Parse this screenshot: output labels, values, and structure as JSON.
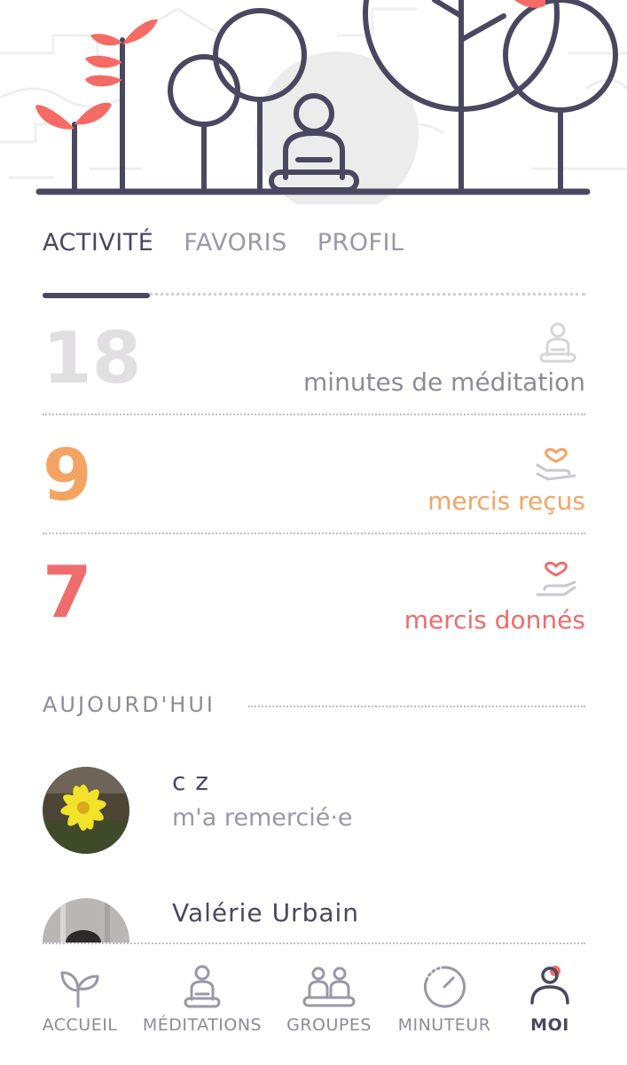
{
  "tabs": [
    {
      "label": "ACTIVITÉ",
      "active": true
    },
    {
      "label": "FAVORIS",
      "active": false
    },
    {
      "label": "PROFIL",
      "active": false
    }
  ],
  "stats": [
    {
      "value": "18",
      "label": "minutes de méditation",
      "color": "#e1dfe2",
      "label_color": "#8d8b98",
      "icon": "meditation-icon"
    },
    {
      "value": "9",
      "label": "mercis reçus",
      "color": "#f4a462",
      "label_color": "#f4a462",
      "icon": "heart-hand-received-icon"
    },
    {
      "value": "7",
      "label": "mercis donnés",
      "color": "#ef6c6c",
      "label_color": "#ef6c6c",
      "icon": "heart-hand-given-icon"
    }
  ],
  "section": {
    "title": "AUJOURD'HUI"
  },
  "activities": [
    {
      "name": "c z",
      "action": "m'a remercié·e",
      "avatar": "flower-avatar"
    },
    {
      "name": "Valérie  Urbain",
      "action": "",
      "avatar": "person-avatar"
    }
  ],
  "nav": [
    {
      "label": "ACCUEIL",
      "icon": "sprout-icon",
      "active": false
    },
    {
      "label": "MÉDITATIONS",
      "icon": "meditation-icon",
      "active": false
    },
    {
      "label": "GROUPES",
      "icon": "group-icon",
      "active": false
    },
    {
      "label": "MINUTEUR",
      "icon": "timer-icon",
      "active": false
    },
    {
      "label": "MOI",
      "icon": "user-icon",
      "active": true
    }
  ],
  "colors": {
    "dark": "#4a4760",
    "coral": "#f56b63",
    "orange": "#f4a462",
    "gray": "#9a98a6"
  }
}
